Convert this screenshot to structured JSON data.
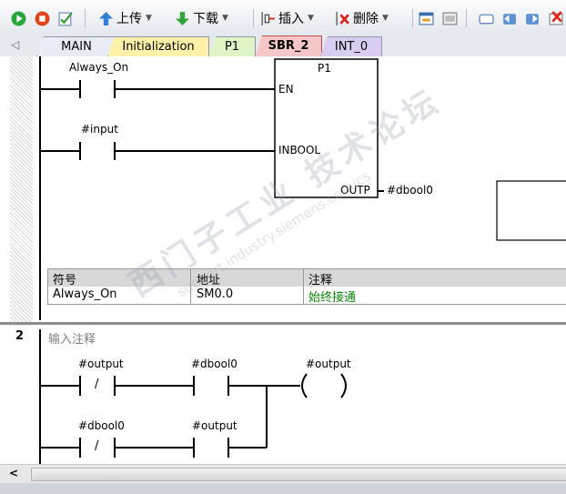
{
  "toolbar": {
    "upload_label": "上传",
    "download_label": "下载",
    "insert_label": "插入",
    "delete_label": "删除"
  },
  "tabs": [
    {
      "label": "MAIN",
      "color": "#e8ecf4"
    },
    {
      "label": "Initialization",
      "color": "#fff2a8"
    },
    {
      "label": "P1",
      "color": "#dff5c8"
    },
    {
      "label": "SBR_2",
      "color": "#f7c6c6",
      "active": true
    },
    {
      "label": "INT_0",
      "color": "#d9cdf2"
    }
  ],
  "rung1": {
    "contact1_label": "Always_On",
    "contact2_label": "#input",
    "block_title": "P1",
    "pin_en": "EN",
    "pin_inbool": "INBOOL",
    "pin_outp": "OUTP",
    "outp_var": "#dbool0"
  },
  "symbol_table": {
    "headers": [
      "符号",
      "地址",
      "注释"
    ],
    "rows": [
      {
        "symbol": "Always_On",
        "address": "SM0.0",
        "comment": "始终接通"
      }
    ]
  },
  "rung2": {
    "number": "2",
    "comment": "输入注释",
    "c1_label": "#output",
    "c2_label": "#dbool0",
    "coil_label": "#output",
    "c3_label": "#dbool0",
    "c4_label": "#output",
    "nc_symbol": "/"
  },
  "watermark": {
    "line1": "西门子工业 技术论坛",
    "line2": "support.industry.siemens.com/cs"
  },
  "scrollbar": {
    "left_arrow": "<"
  }
}
